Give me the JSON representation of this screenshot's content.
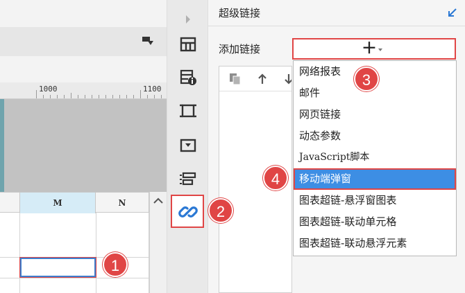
{
  "ruler": {
    "labels": [
      "1000",
      "1100"
    ]
  },
  "sheet": {
    "columns": [
      "M",
      "N"
    ]
  },
  "toolbar": {
    "icons": [
      "frozen-cells-icon",
      "cell-info-icon",
      "border-icon",
      "widget-icon",
      "layout-icon",
      "hyperlink-icon"
    ]
  },
  "panel": {
    "title": "超级链接",
    "add_label": "添加链接",
    "add_button": "＋"
  },
  "link_menu": {
    "items": [
      "网络报表",
      "邮件",
      "网页链接",
      "动态参数",
      "JavaScript脚本",
      "移动端弹窗",
      "图表超链-悬浮窗图表",
      "图表超链-联动单元格",
      "图表超链-联动悬浮元素"
    ],
    "selected": "移动端弹窗"
  },
  "callouts": [
    "1",
    "2",
    "3",
    "4"
  ],
  "colors": {
    "accent_red": "#e04545",
    "selection_blue": "#3d8ee4",
    "column_highlight": "#d6ecf7"
  }
}
